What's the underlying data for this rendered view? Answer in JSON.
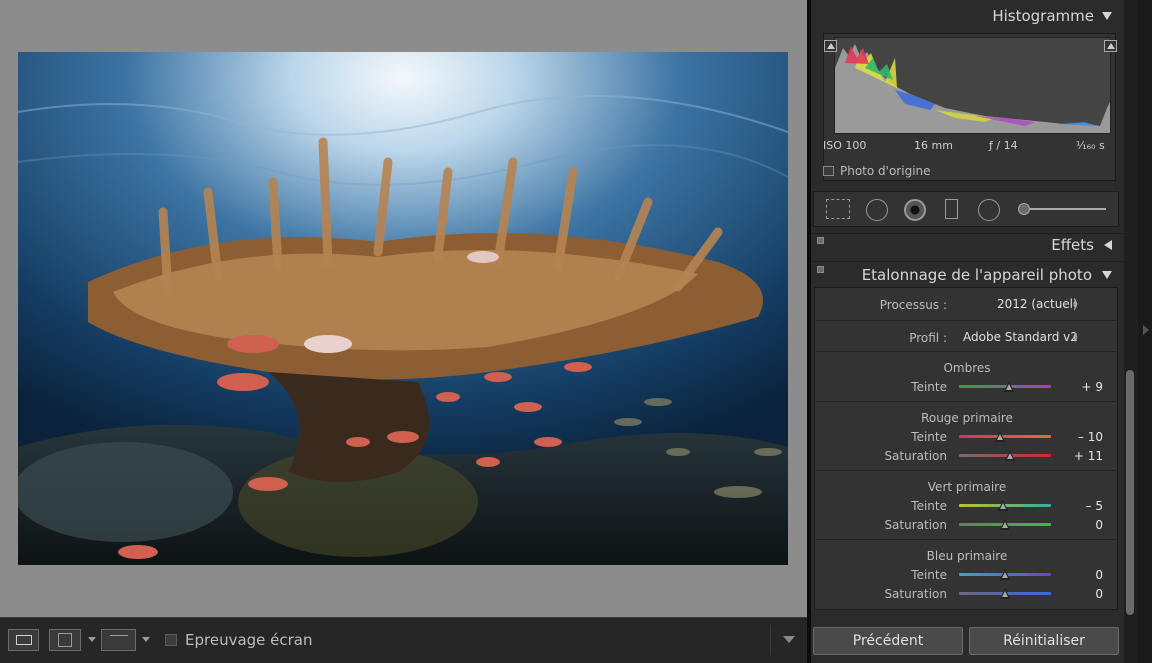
{
  "histogram": {
    "title": "Histogramme",
    "exif": {
      "iso": "ISO 100",
      "focal": "16 mm",
      "aperture": "ƒ / 14",
      "shutter": "¹⁄₁₆₀ s"
    },
    "original_label": "Photo d'origine"
  },
  "effects": {
    "title": "Effets"
  },
  "calibration": {
    "title": "Etalonnage de l'appareil photo",
    "process_label": "Processus :",
    "process_value": "2012 (actuel)",
    "profile_label": "Profil :",
    "profile_value": "Adobe Standard v2",
    "groups": [
      {
        "title": "Ombres",
        "sliders": [
          {
            "label": "Teinte",
            "value": "+ 9",
            "num": 9
          }
        ]
      },
      {
        "title": "Rouge primaire",
        "sliders": [
          {
            "label": "Teinte",
            "value": "– 10",
            "num": -10
          },
          {
            "label": "Saturation",
            "value": "+ 11",
            "num": 11
          }
        ]
      },
      {
        "title": "Vert primaire",
        "sliders": [
          {
            "label": "Teinte",
            "value": "– 5",
            "num": -5
          },
          {
            "label": "Saturation",
            "value": "0",
            "num": 0
          }
        ]
      },
      {
        "title": "Bleu primaire",
        "sliders": [
          {
            "label": "Teinte",
            "value": "0",
            "num": 0
          },
          {
            "label": "Saturation",
            "value": "0",
            "num": 0
          }
        ]
      }
    ]
  },
  "buttons": {
    "previous": "Précédent",
    "reset": "Réinitialiser"
  },
  "toolbar": {
    "softproof_label": "Epreuvage écran"
  },
  "colors": {
    "panel_bg": "#2b2b2b",
    "viewer_bg": "#8c8c8c",
    "water": "#1d4b74",
    "coral": "#a8743f"
  },
  "photo": {
    "description": "underwater-coral-reef-with-red-soldierfish"
  }
}
